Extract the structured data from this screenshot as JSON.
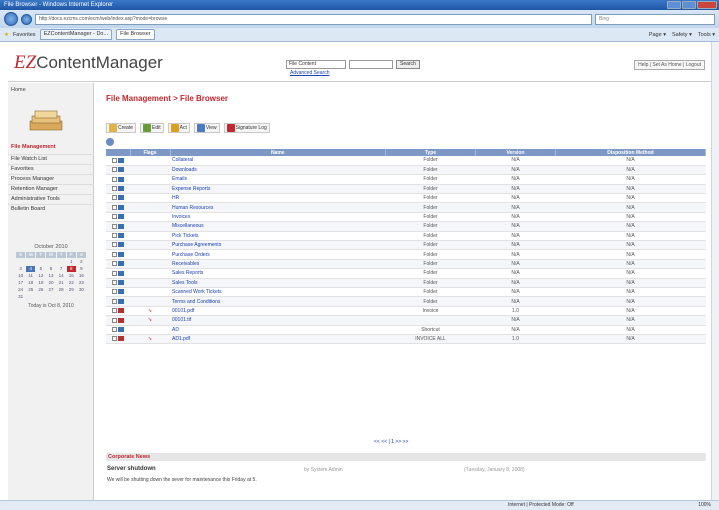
{
  "browser": {
    "title": "File Browser - Windows Internet Explorer",
    "address": "http://docs.ezcms.com/ecm/web/index.asp?mode=browse",
    "search_placeholder": "Bing",
    "favorites_label": "Favorites",
    "tabs": [
      "EZContentManager - Do...",
      "File Browser"
    ],
    "tools": [
      "Page ▾",
      "Safety ▾",
      "Tools ▾"
    ],
    "status_zone": "Internet | Protected Mode: Off",
    "zoom": "100%"
  },
  "header": {
    "logo_ez": "EZ",
    "logo_rest": "ContentManager",
    "search_select": "File Content",
    "search_button": "Search",
    "advanced_search": "Advanced Search",
    "links": "Help | Set As Home | Logout"
  },
  "sidebar": {
    "home": "Home",
    "file_management": "File Management",
    "items": [
      "File Watch List",
      "Favorites",
      "Process Manager",
      "Retention Manager",
      "Administrative Tools",
      "Bulletin Board"
    ],
    "calendar": {
      "month": "October 2010",
      "dow": [
        "S",
        "M",
        "T",
        "W",
        "T",
        "F",
        "S"
      ],
      "days": [
        "",
        "",
        "",
        "",
        "",
        "1",
        "2",
        "3",
        "4",
        "5",
        "6",
        "7",
        "8",
        "9",
        "10",
        "11",
        "12",
        "13",
        "14",
        "15",
        "16",
        "17",
        "18",
        "19",
        "20",
        "21",
        "22",
        "23",
        "24",
        "25",
        "26",
        "27",
        "28",
        "29",
        "30",
        "31",
        "",
        "",
        "",
        "",
        "",
        ""
      ],
      "today_text": "Today is Oct 8, 2010"
    }
  },
  "main": {
    "breadcrumb": "File Management > File Browser",
    "toolbar": [
      "Create",
      "Edit",
      "Act",
      "View",
      "Signature Log"
    ],
    "columns": [
      "",
      "Flags",
      "Name",
      "Type",
      "Version",
      "Disposition Method"
    ],
    "rows": [
      {
        "name": "Collateral",
        "type": "Folder",
        "version": "N/A",
        "disp": "N/A",
        "doc": false,
        "flag": false
      },
      {
        "name": "Downloads",
        "type": "Folder",
        "version": "N/A",
        "disp": "N/A",
        "doc": false,
        "flag": false
      },
      {
        "name": "Emails",
        "type": "Folder",
        "version": "N/A",
        "disp": "N/A",
        "doc": false,
        "flag": false
      },
      {
        "name": "Expense Reports",
        "type": "Folder",
        "version": "N/A",
        "disp": "N/A",
        "doc": false,
        "flag": false
      },
      {
        "name": "HR",
        "type": "Folder",
        "version": "N/A",
        "disp": "N/A",
        "doc": false,
        "flag": false
      },
      {
        "name": "Human Resources",
        "type": "Folder",
        "version": "N/A",
        "disp": "N/A",
        "doc": false,
        "flag": false
      },
      {
        "name": "Invoices",
        "type": "Folder",
        "version": "N/A",
        "disp": "N/A",
        "doc": false,
        "flag": false
      },
      {
        "name": "Miscellaneous",
        "type": "Folder",
        "version": "N/A",
        "disp": "N/A",
        "doc": false,
        "flag": false
      },
      {
        "name": "Pick Tickets",
        "type": "Folder",
        "version": "N/A",
        "disp": "N/A",
        "doc": false,
        "flag": false
      },
      {
        "name": "Purchase Agreements",
        "type": "Folder",
        "version": "N/A",
        "disp": "N/A",
        "doc": false,
        "flag": false
      },
      {
        "name": "Purchase Orders",
        "type": "Folder",
        "version": "N/A",
        "disp": "N/A",
        "doc": false,
        "flag": false
      },
      {
        "name": "Receivables",
        "type": "Folder",
        "version": "N/A",
        "disp": "N/A",
        "doc": false,
        "flag": false
      },
      {
        "name": "Sales Reports",
        "type": "Folder",
        "version": "N/A",
        "disp": "N/A",
        "doc": false,
        "flag": false
      },
      {
        "name": "Sales Tools",
        "type": "Folder",
        "version": "N/A",
        "disp": "N/A",
        "doc": false,
        "flag": false
      },
      {
        "name": "Scanned Work Tickets",
        "type": "Folder",
        "version": "N/A",
        "disp": "N/A",
        "doc": false,
        "flag": false
      },
      {
        "name": "Terms and Conditions",
        "type": "Folder",
        "version": "N/A",
        "disp": "N/A",
        "doc": false,
        "flag": false
      },
      {
        "name": "00101.pdf",
        "type": "Invoice",
        "version": "1.0",
        "disp": "N/A",
        "doc": true,
        "flag": true
      },
      {
        "name": "00101.tif",
        "type": "",
        "version": "N/A",
        "disp": "N/A",
        "doc": true,
        "flag": true
      },
      {
        "name": "AD",
        "type": "Shortcut",
        "version": "N/A",
        "disp": "N/A",
        "doc": false,
        "flag": false
      },
      {
        "name": "AD1.pdf",
        "type": "INVOICE ALL",
        "version": "1.0",
        "disp": "N/A",
        "doc": true,
        "flag": true
      }
    ],
    "pager": "<< << | 1 >> >>"
  },
  "news": {
    "heading": "Corporate News",
    "title": "Server shutdown",
    "by": "by System Admin",
    "date": "(Tuesday, January 8, 2008)",
    "body": "We will be shutting down the sever for maintenance this Friday at 5."
  },
  "colors": {
    "accent": "#c0282e",
    "header_bg": "#7d98c5",
    "link": "#1a3fb0"
  }
}
